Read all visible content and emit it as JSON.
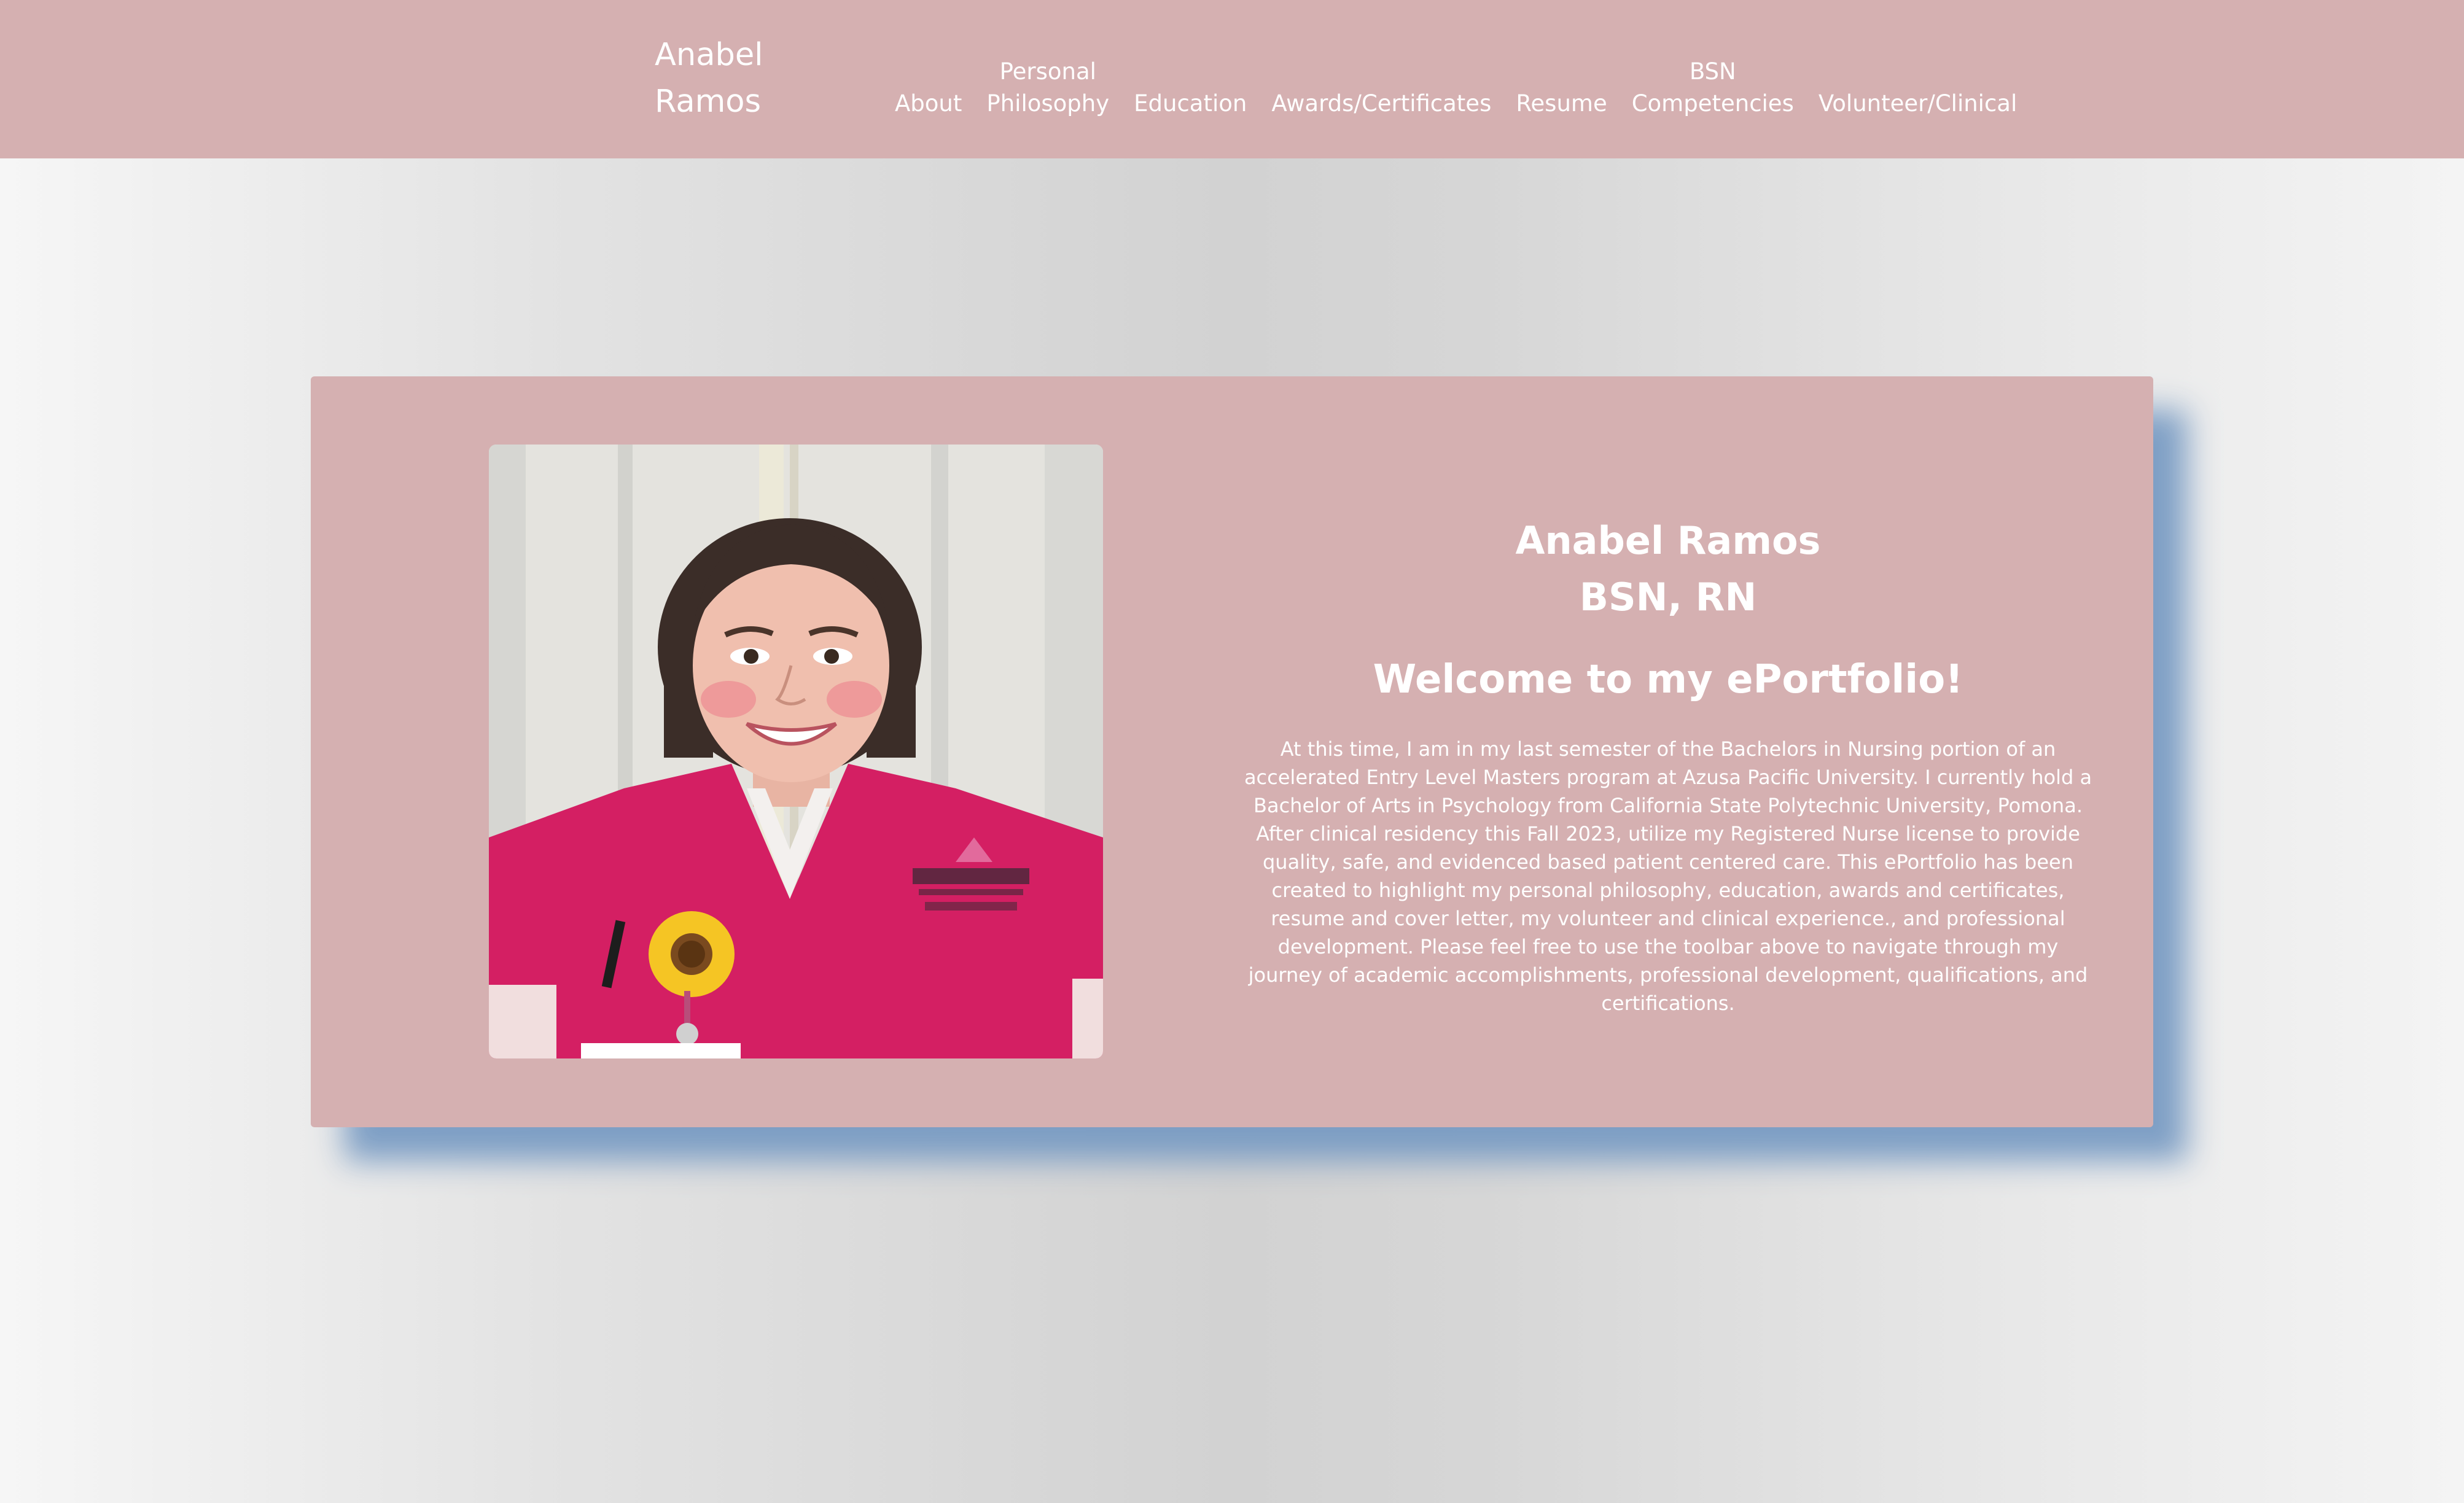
{
  "header": {
    "site_title_line1": "Anabel",
    "site_title_line2": "Ramos",
    "nav": {
      "about": "About",
      "personal_philosophy_line1": "Personal",
      "personal_philosophy_line2": "Philosophy",
      "education": "Education",
      "awards": "Awards/Certificates",
      "resume": "Resume",
      "bsn_competencies_line1": "BSN",
      "bsn_competencies_line2": "Competencies",
      "volunteer": "Volunteer/Clinical"
    }
  },
  "hero": {
    "name": "Anabel Ramos",
    "credentials": "BSN, RN",
    "welcome": "Welcome to my ePortfolio!",
    "intro": "At this time, I am in my last semester of the Bachelors in Nursing portion of an accelerated Entry Level Masters program at Azusa Pacific University. I currently hold a Bachelor of Arts in Psychology from California State Polytechnic University, Pomona. After clinical residency this Fall 2023, utilize my Registered Nurse license to provide quality, safe, and evidenced based patient centered care. This ePortfolio has been created to highlight my personal philosophy, education, awards and certificates, resume and cover letter, my volunteer and clinical experience., and professional development. Please feel free to use the toolbar above to navigate through my journey of academic accomplishments, professional development, qualifications, and certifications."
  },
  "colors": {
    "brand_pink": "#d5b0b1",
    "card_shadow": "#789bc3",
    "text": "#ffffff"
  }
}
